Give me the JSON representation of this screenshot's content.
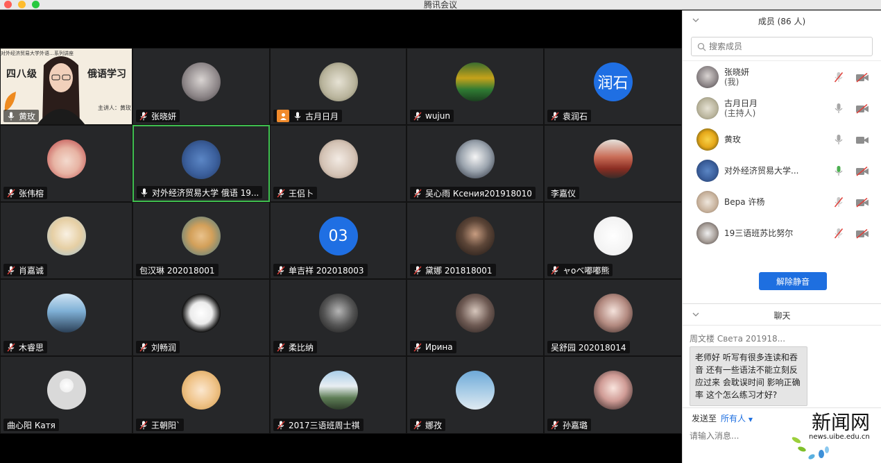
{
  "window": {
    "title": "腾讯会议"
  },
  "slide": {
    "header": "对外经济贸易大学外语…系列讲座",
    "big_left": "四八级",
    "big_right": "俄语学习",
    "sub": "主讲人：黄玫"
  },
  "tiles": [
    {
      "name": "黄玫",
      "muted": false,
      "avatar": "slide"
    },
    {
      "name": "张晓妍",
      "muted": true,
      "avatar": "anime"
    },
    {
      "name": "古月日月",
      "muted": false,
      "host": true,
      "avatar": "child-reading"
    },
    {
      "name": "wujun",
      "muted": true,
      "avatar": "landscape"
    },
    {
      "name": "袁润石",
      "muted": true,
      "avatar": "initials",
      "initials": "润石",
      "color": "#1f6fe3"
    },
    {
      "name": "张伟榕",
      "muted": true,
      "avatar": "mermaid"
    },
    {
      "name": "对外经济贸易大学 俄语 19...",
      "muted": false,
      "active": true,
      "avatar": "stitch"
    },
    {
      "name": "王侣卜",
      "muted": true,
      "avatar": "baby"
    },
    {
      "name": "吴心雨 Ксения201918010",
      "muted": true,
      "avatar": "man-suit"
    },
    {
      "name": "李嘉仪",
      "muted": null,
      "avatar": "train"
    },
    {
      "name": "肖嘉诚",
      "muted": true,
      "avatar": "anime-boy"
    },
    {
      "name": "包汉琳 202018001",
      "muted": null,
      "avatar": "vibe"
    },
    {
      "name": "单吉祥 202018003",
      "muted": true,
      "avatar": "initials",
      "initials": "03",
      "color": "#1f6fe3"
    },
    {
      "name": "黛娜 201818001",
      "muted": true,
      "avatar": "dark-girl"
    },
    {
      "name": "ャoベ嘟嘟熊",
      "muted": true,
      "avatar": "snoopy"
    },
    {
      "name": "木睿思",
      "muted": true,
      "avatar": "blue-person"
    },
    {
      "name": "刘畅润",
      "muted": true,
      "avatar": "calligraphy"
    },
    {
      "name": "柔比纳",
      "muted": true,
      "avatar": "bw-girl"
    },
    {
      "name": "Ирина",
      "muted": true,
      "avatar": "dark-girl2"
    },
    {
      "name": "吴舒园 202018014",
      "muted": null,
      "avatar": "girl-long-hair"
    },
    {
      "name": "曲心阳  Катя",
      "muted": null,
      "avatar": "default"
    },
    {
      "name": "王朝阳`",
      "muted": true,
      "avatar": "cartoon-girl"
    },
    {
      "name": "2017三语班周士祺",
      "muted": true,
      "avatar": "scenery"
    },
    {
      "name": "娜孜",
      "muted": true,
      "avatar": "sky-girl"
    },
    {
      "name": "孙嘉璐",
      "muted": true,
      "avatar": "girl-flowers"
    }
  ],
  "members": {
    "title": "成员 (86 人)",
    "search_placeholder": "搜索成员",
    "list": [
      {
        "name": "张晓妍",
        "role": "(我)",
        "mic": "muted",
        "cam": "off",
        "avatar": "anime"
      },
      {
        "name": "古月日月",
        "role": "(主持人)",
        "mic": "on",
        "cam": "off",
        "avatar": "child-reading"
      },
      {
        "name": "黄玫",
        "role": "",
        "mic": "on",
        "cam": "on",
        "avatar": "rose"
      },
      {
        "name": "对外经济贸易大学...",
        "role": "",
        "mic": "active",
        "cam": "off",
        "avatar": "stitch"
      },
      {
        "name": "Bера 许杨",
        "role": "",
        "mic": "muted",
        "cam": "off",
        "avatar": "dog"
      },
      {
        "name": "19三语班苏比努尔",
        "role": "",
        "mic": "muted",
        "cam": "off",
        "avatar": "girl-sit"
      }
    ],
    "unmute_label": "解除静音"
  },
  "chat": {
    "title": "聊天",
    "from": "周文楼 Света 201918...",
    "message": "老师好 听写有很多连读和吞音 还有一些语法不能立刻反应过来 会耽误时间 影响正确率 这个怎么练习才好?",
    "send_to_label": "发送至",
    "send_to_target": "所有人",
    "input_placeholder": "请输入消息..."
  },
  "watermark": {
    "title": "新闻网",
    "url": "news.uibe.edu.cn"
  },
  "colors": {
    "accent": "#1e6fe0",
    "tile_bg": "#262729",
    "active_border": "#3fbf4f",
    "muted_red": "#e0403a"
  }
}
